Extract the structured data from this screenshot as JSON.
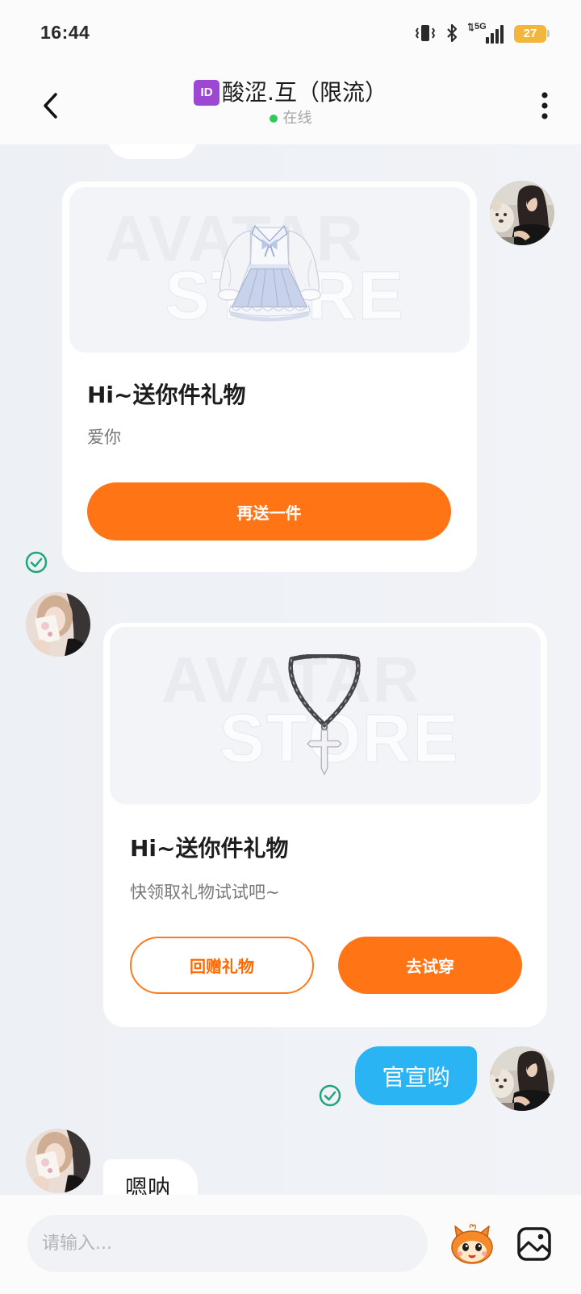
{
  "status_bar": {
    "time": "16:44",
    "network": "5G",
    "battery": "27"
  },
  "header": {
    "title_badge": "ID",
    "title": "酸涩.互（限流）",
    "presence": "在线"
  },
  "messages": [
    {
      "type": "gift",
      "sender": "me",
      "watermark_top": "AVATAR",
      "watermark_bottom": "STORE",
      "title": "Hi~送你件礼物",
      "subtitle": "爱你",
      "primary_button": "再送一件"
    },
    {
      "type": "gift",
      "sender": "other",
      "watermark_top": "AVATAR",
      "watermark_bottom": "STORE",
      "title": "Hi~送你件礼物",
      "subtitle": "快领取礼物试试吧~",
      "secondary_button": "回赠礼物",
      "primary_button": "去试穿"
    },
    {
      "type": "text",
      "sender": "me",
      "text": "官宣哟"
    },
    {
      "type": "text",
      "sender": "other",
      "text": "嗯呐"
    }
  ],
  "composer": {
    "placeholder": "请输入..."
  },
  "icons": {
    "back": "chevron-left-icon",
    "more": "more-vertical-icon",
    "vibrate": "vibrate-icon",
    "bluetooth": "bluetooth-icon",
    "signal": "signal-icon",
    "battery": "battery-icon",
    "delivered": "check-circle-icon",
    "sticker": "mascot-sticker-icon",
    "image": "image-icon"
  },
  "colors": {
    "accent": "#ff7415",
    "bubble_me": "#2bb4f3",
    "delivered_check": "#1ea67a",
    "online": "#2fcb5a",
    "badge": "#9c48d2",
    "battery": "#f4b63a"
  }
}
